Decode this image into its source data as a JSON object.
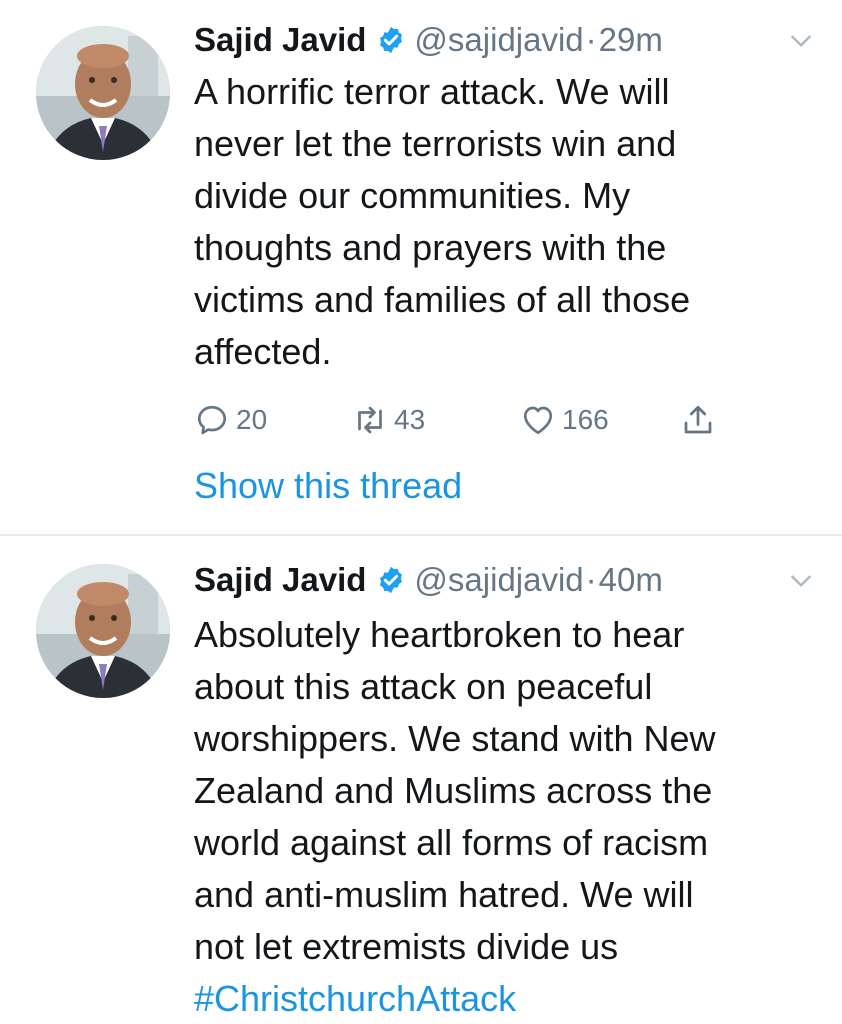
{
  "colors": {
    "link": "#1b95e0",
    "secondary_text": "#657786",
    "primary_text": "#14171a",
    "verified_badge": "#1da1f2",
    "divider": "#e6ecf0"
  },
  "tweets": [
    {
      "author": {
        "name": "Sajid Javid",
        "handle": "@sajidjavid",
        "verified_icon": "verified-badge-icon",
        "avatar": "profile-photo"
      },
      "separator": "·",
      "time": "29m",
      "menu_icon": "chevron-down-icon",
      "text": "A horrific terror attack. We will\nnever let the terrorists win and\ndivide our communities. My\nthoughts and prayers with the\nvictims and families of all those\naffected.",
      "actions": {
        "reply": {
          "icon": "reply-icon",
          "count": "20"
        },
        "retweet": {
          "icon": "retweet-icon",
          "count": "43"
        },
        "like": {
          "icon": "heart-icon",
          "count": "166"
        },
        "share": {
          "icon": "share-icon"
        }
      },
      "thread_link": "Show this thread"
    },
    {
      "author": {
        "name": "Sajid Javid",
        "handle": "@sajidjavid",
        "verified_icon": "verified-badge-icon",
        "avatar": "profile-photo"
      },
      "separator": "·",
      "time": "40m",
      "menu_icon": "chevron-down-icon",
      "text": "Absolutely heartbroken to hear\nabout this attack on peaceful\nworshippers. We stand with New\nZealand and Muslims across the\nworld against all forms of racism\nand anti-muslim hatred. We will\nnot let extremists divide us",
      "hashtag": "#ChristchurchAttack"
    }
  ]
}
